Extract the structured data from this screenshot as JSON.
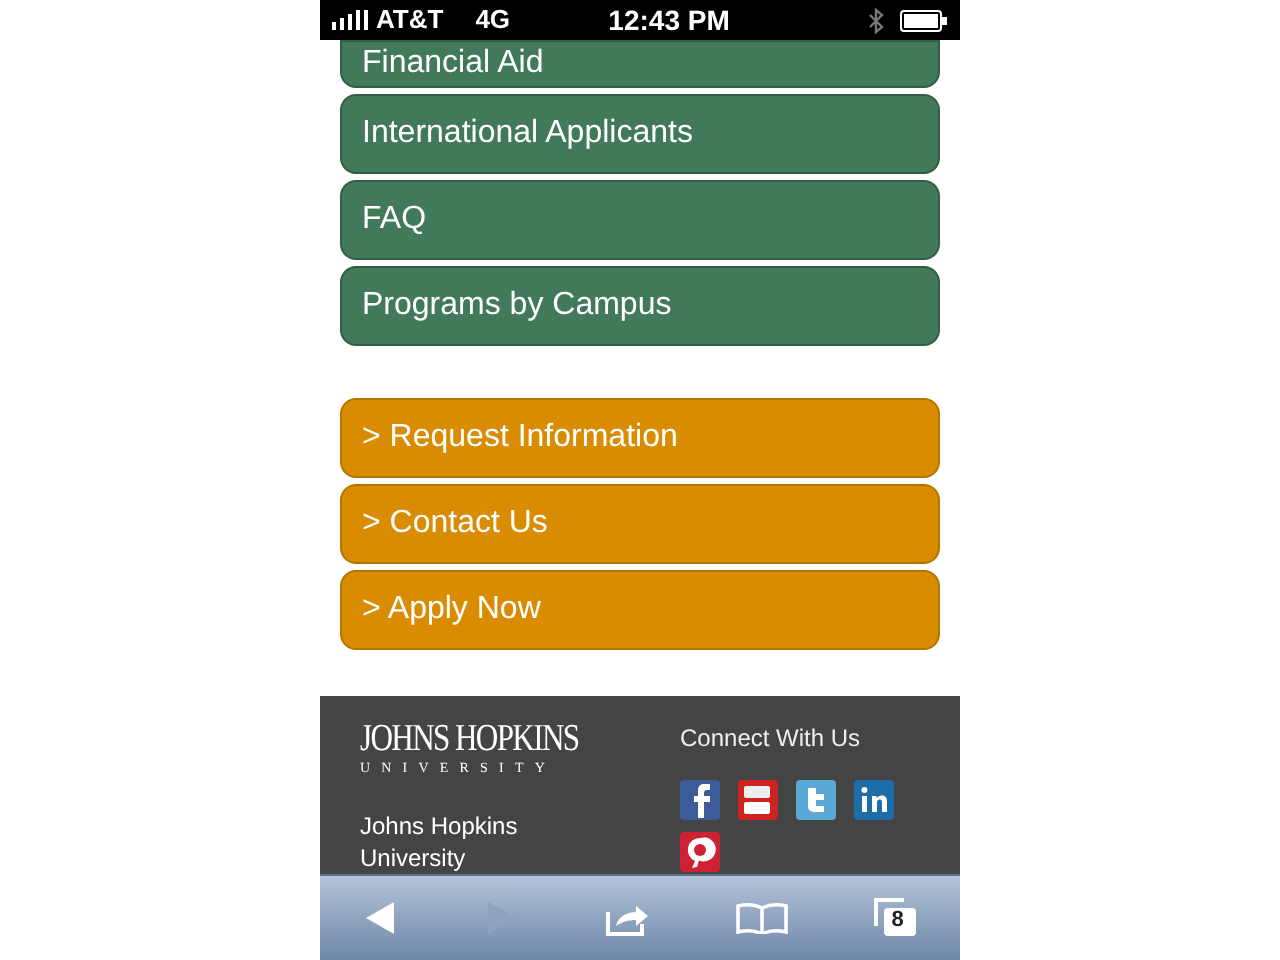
{
  "status_bar": {
    "carrier": "AT&T",
    "network": "4G",
    "time": "12:43 PM"
  },
  "menu_links": [
    {
      "label": "Financial Aid"
    },
    {
      "label": "International Applicants"
    },
    {
      "label": "FAQ"
    },
    {
      "label": "Programs by Campus"
    }
  ],
  "action_links": [
    {
      "label": "> Request Information"
    },
    {
      "label": "> Contact Us"
    },
    {
      "label": "> Apply Now"
    }
  ],
  "footer": {
    "logo_title": "JOHNS HOPKINS",
    "logo_subtitle": "UNIVERSITY",
    "address_lines": [
      "Johns Hopkins",
      "University"
    ],
    "connect_heading": "Connect With Us"
  },
  "toolbar": [
    {
      "kind": "back",
      "disabled": false
    },
    {
      "kind": "forward",
      "disabled": true
    },
    {
      "kind": "share"
    },
    {
      "kind": "bookmarks"
    },
    {
      "kind": "tabs",
      "count": "8"
    }
  ]
}
